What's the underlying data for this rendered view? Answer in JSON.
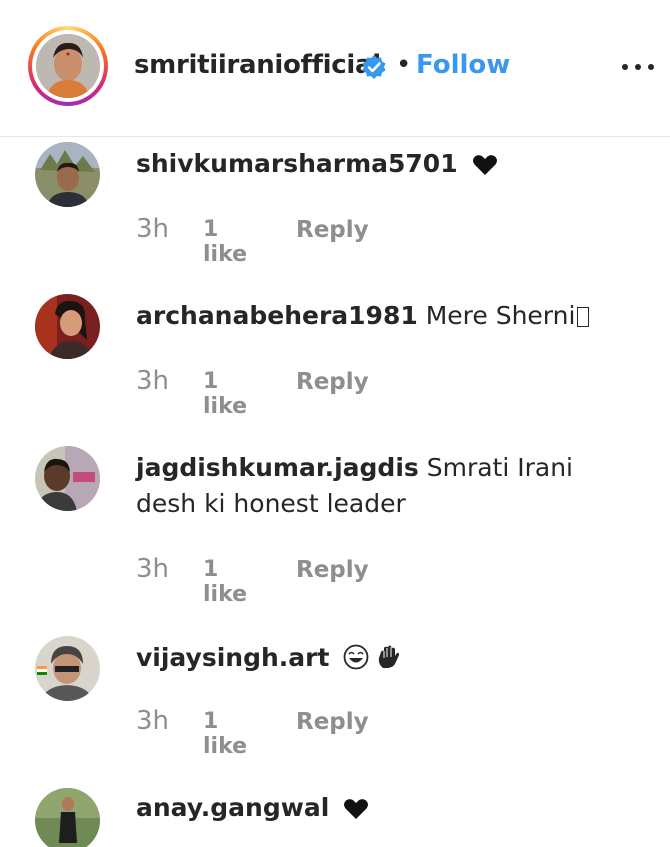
{
  "header": {
    "username": "smritiiraniofficial",
    "separator": "•",
    "follow_label": "Follow"
  },
  "comments": [
    {
      "username": "shivkumarsharma5701",
      "text": "",
      "time": "3h",
      "likes": "1 like",
      "reply": "Reply",
      "emoji": "black-heart-icon"
    },
    {
      "username": "archanabehera1981",
      "text": "Mere Sherni",
      "time": "3h",
      "likes": "1 like",
      "reply": "Reply",
      "emoji": "missing-glyph-icon"
    },
    {
      "username": "jagdishkumar.jagdis",
      "text": "Smrati Irani desh ki honest leader",
      "time": "3h",
      "likes": "1 like",
      "reply": "Reply"
    },
    {
      "username": "vijaysingh.art",
      "text": "",
      "time": "3h",
      "likes": "1 like",
      "reply": "Reply",
      "emoji": "laughing-face-icon, waving-hand-icon"
    },
    {
      "username": "anay.gangwal",
      "text": "",
      "emoji": "black-heart-icon"
    }
  ],
  "colors": {
    "link": "#3897f0",
    "text": "#262626",
    "meta": "#8e8e8e",
    "divider": "#e6e6e6"
  }
}
